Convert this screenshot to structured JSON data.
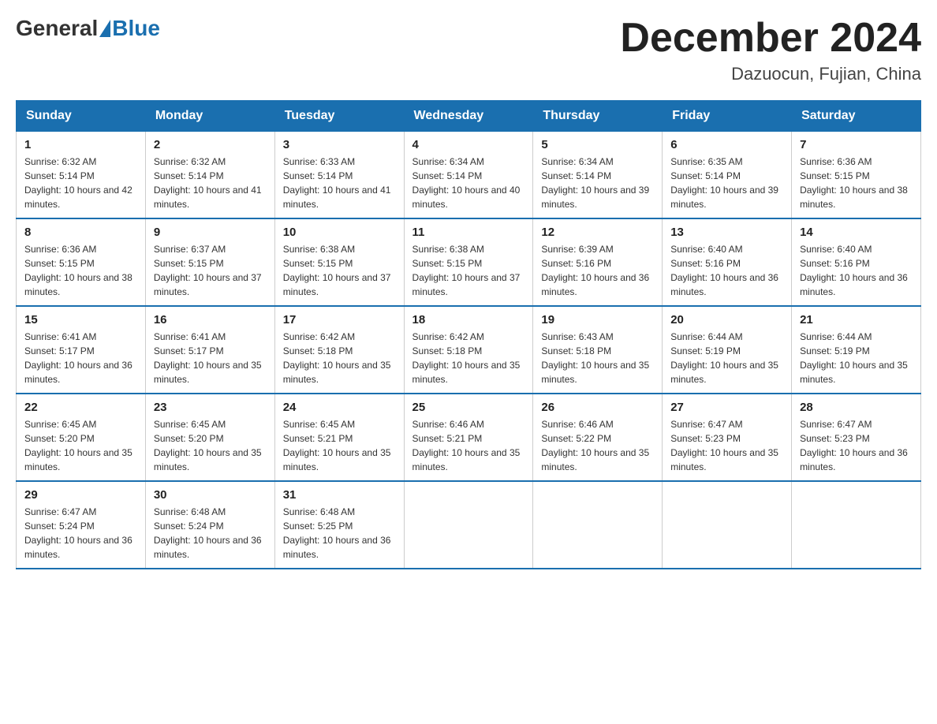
{
  "header": {
    "logo_general": "General",
    "logo_blue": "Blue",
    "month_title": "December 2024",
    "location": "Dazuocun, Fujian, China"
  },
  "weekdays": [
    "Sunday",
    "Monday",
    "Tuesday",
    "Wednesday",
    "Thursday",
    "Friday",
    "Saturday"
  ],
  "weeks": [
    [
      {
        "day": "1",
        "sunrise": "6:32 AM",
        "sunset": "5:14 PM",
        "daylight": "10 hours and 42 minutes."
      },
      {
        "day": "2",
        "sunrise": "6:32 AM",
        "sunset": "5:14 PM",
        "daylight": "10 hours and 41 minutes."
      },
      {
        "day": "3",
        "sunrise": "6:33 AM",
        "sunset": "5:14 PM",
        "daylight": "10 hours and 41 minutes."
      },
      {
        "day": "4",
        "sunrise": "6:34 AM",
        "sunset": "5:14 PM",
        "daylight": "10 hours and 40 minutes."
      },
      {
        "day": "5",
        "sunrise": "6:34 AM",
        "sunset": "5:14 PM",
        "daylight": "10 hours and 39 minutes."
      },
      {
        "day": "6",
        "sunrise": "6:35 AM",
        "sunset": "5:14 PM",
        "daylight": "10 hours and 39 minutes."
      },
      {
        "day": "7",
        "sunrise": "6:36 AM",
        "sunset": "5:15 PM",
        "daylight": "10 hours and 38 minutes."
      }
    ],
    [
      {
        "day": "8",
        "sunrise": "6:36 AM",
        "sunset": "5:15 PM",
        "daylight": "10 hours and 38 minutes."
      },
      {
        "day": "9",
        "sunrise": "6:37 AM",
        "sunset": "5:15 PM",
        "daylight": "10 hours and 37 minutes."
      },
      {
        "day": "10",
        "sunrise": "6:38 AM",
        "sunset": "5:15 PM",
        "daylight": "10 hours and 37 minutes."
      },
      {
        "day": "11",
        "sunrise": "6:38 AM",
        "sunset": "5:15 PM",
        "daylight": "10 hours and 37 minutes."
      },
      {
        "day": "12",
        "sunrise": "6:39 AM",
        "sunset": "5:16 PM",
        "daylight": "10 hours and 36 minutes."
      },
      {
        "day": "13",
        "sunrise": "6:40 AM",
        "sunset": "5:16 PM",
        "daylight": "10 hours and 36 minutes."
      },
      {
        "day": "14",
        "sunrise": "6:40 AM",
        "sunset": "5:16 PM",
        "daylight": "10 hours and 36 minutes."
      }
    ],
    [
      {
        "day": "15",
        "sunrise": "6:41 AM",
        "sunset": "5:17 PM",
        "daylight": "10 hours and 36 minutes."
      },
      {
        "day": "16",
        "sunrise": "6:41 AM",
        "sunset": "5:17 PM",
        "daylight": "10 hours and 35 minutes."
      },
      {
        "day": "17",
        "sunrise": "6:42 AM",
        "sunset": "5:18 PM",
        "daylight": "10 hours and 35 minutes."
      },
      {
        "day": "18",
        "sunrise": "6:42 AM",
        "sunset": "5:18 PM",
        "daylight": "10 hours and 35 minutes."
      },
      {
        "day": "19",
        "sunrise": "6:43 AM",
        "sunset": "5:18 PM",
        "daylight": "10 hours and 35 minutes."
      },
      {
        "day": "20",
        "sunrise": "6:44 AM",
        "sunset": "5:19 PM",
        "daylight": "10 hours and 35 minutes."
      },
      {
        "day": "21",
        "sunrise": "6:44 AM",
        "sunset": "5:19 PM",
        "daylight": "10 hours and 35 minutes."
      }
    ],
    [
      {
        "day": "22",
        "sunrise": "6:45 AM",
        "sunset": "5:20 PM",
        "daylight": "10 hours and 35 minutes."
      },
      {
        "day": "23",
        "sunrise": "6:45 AM",
        "sunset": "5:20 PM",
        "daylight": "10 hours and 35 minutes."
      },
      {
        "day": "24",
        "sunrise": "6:45 AM",
        "sunset": "5:21 PM",
        "daylight": "10 hours and 35 minutes."
      },
      {
        "day": "25",
        "sunrise": "6:46 AM",
        "sunset": "5:21 PM",
        "daylight": "10 hours and 35 minutes."
      },
      {
        "day": "26",
        "sunrise": "6:46 AM",
        "sunset": "5:22 PM",
        "daylight": "10 hours and 35 minutes."
      },
      {
        "day": "27",
        "sunrise": "6:47 AM",
        "sunset": "5:23 PM",
        "daylight": "10 hours and 35 minutes."
      },
      {
        "day": "28",
        "sunrise": "6:47 AM",
        "sunset": "5:23 PM",
        "daylight": "10 hours and 36 minutes."
      }
    ],
    [
      {
        "day": "29",
        "sunrise": "6:47 AM",
        "sunset": "5:24 PM",
        "daylight": "10 hours and 36 minutes."
      },
      {
        "day": "30",
        "sunrise": "6:48 AM",
        "sunset": "5:24 PM",
        "daylight": "10 hours and 36 minutes."
      },
      {
        "day": "31",
        "sunrise": "6:48 AM",
        "sunset": "5:25 PM",
        "daylight": "10 hours and 36 minutes."
      },
      null,
      null,
      null,
      null
    ]
  ]
}
